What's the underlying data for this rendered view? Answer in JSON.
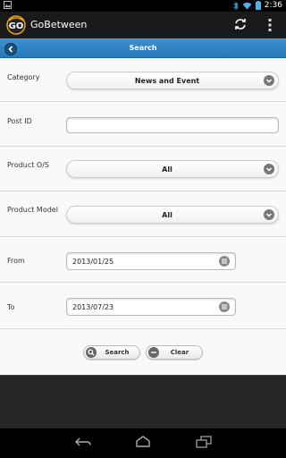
{
  "status_bar": {
    "time": "2:36",
    "icons": [
      "image-notification-icon",
      "bluetooth-icon",
      "wifi-icon",
      "battery-icon"
    ]
  },
  "action_bar": {
    "app_title": "GoBetween",
    "icons": [
      "app-logo-icon",
      "sync-icon",
      "overflow-menu-icon"
    ]
  },
  "header": {
    "title": "Search"
  },
  "form": {
    "category_label": "Category",
    "category_value": "News and Event",
    "post_id_label": "Post ID",
    "post_id_value": "",
    "product_os_label": "Product O/S",
    "product_os_value": "All",
    "product_model_label": "Product Model",
    "product_model_value": "All",
    "from_label": "From",
    "from_value": "2013/01/25",
    "to_label": "To",
    "to_value": "2013/07/23"
  },
  "buttons": {
    "search_label": "Search",
    "clear_label": "Clear"
  },
  "colors": {
    "header_blue": "#2f84c5",
    "action_bar": "#1a1a1a",
    "form_background": "#f9f9f9",
    "footer_background": "#262626"
  },
  "nav_icons": [
    "back-icon",
    "home-icon",
    "recent-apps-icon"
  ]
}
